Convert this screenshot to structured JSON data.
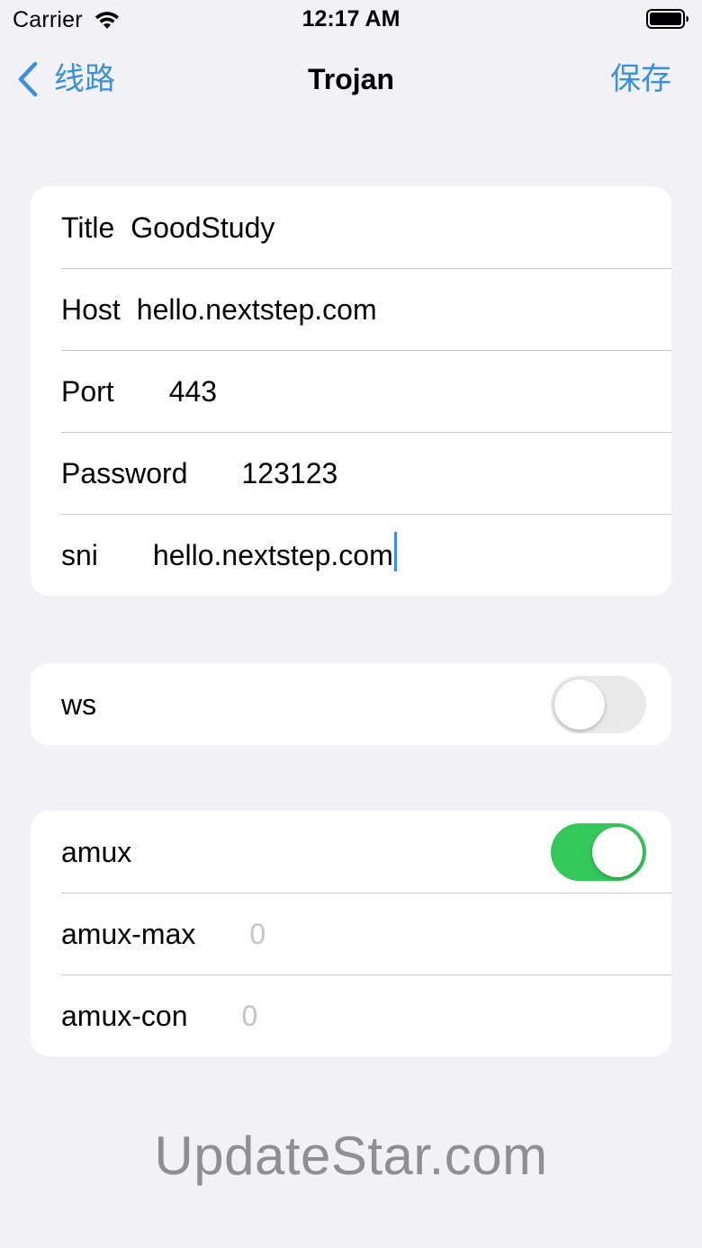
{
  "status_bar": {
    "carrier": "Carrier",
    "time": "12:17 AM"
  },
  "nav": {
    "back_label": "线路",
    "title": "Trojan",
    "save_label": "保存"
  },
  "server_section": {
    "title_row": {
      "label": "Title",
      "value": "GoodStudy"
    },
    "host_row": {
      "label": "Host",
      "value": "hello.nextstep.com"
    },
    "port_row": {
      "label": "Port",
      "value": "443"
    },
    "password_row": {
      "label": "Password",
      "value": "123123"
    },
    "sni_row": {
      "label": "sni",
      "value": "hello.nextstep.com"
    }
  },
  "ws_section": {
    "label": "ws",
    "enabled": false
  },
  "amux_section": {
    "amux_row": {
      "label": "amux",
      "enabled": true
    },
    "amux_max_row": {
      "label": "amux-max",
      "placeholder": "0"
    },
    "amux_con_row": {
      "label": "amux-con",
      "placeholder": "0"
    }
  },
  "watermark": "UpdateStar.com",
  "colors": {
    "background": "#f2f1f6",
    "accent": "#3a8fe0",
    "switch_on": "#34c759",
    "switch_off": "#e9e9ea"
  }
}
